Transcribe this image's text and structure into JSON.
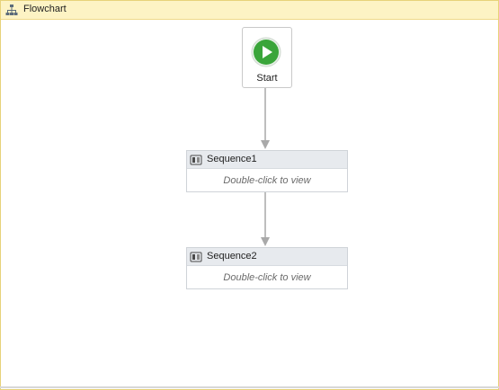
{
  "header": {
    "title": "Flowchart",
    "icon": "flowchart-icon"
  },
  "start": {
    "label": "Start",
    "icon": "play-icon",
    "color": "#3aa53a"
  },
  "sequences": [
    {
      "title": "Sequence1",
      "hint": "Double-click to view",
      "icon": "sequence-icon"
    },
    {
      "title": "Sequence2",
      "hint": "Double-click to view",
      "icon": "sequence-icon"
    }
  ],
  "colors": {
    "header_bg": "#fdf3c4",
    "border": "#e7d27a",
    "connector": "#a9a9a9"
  }
}
